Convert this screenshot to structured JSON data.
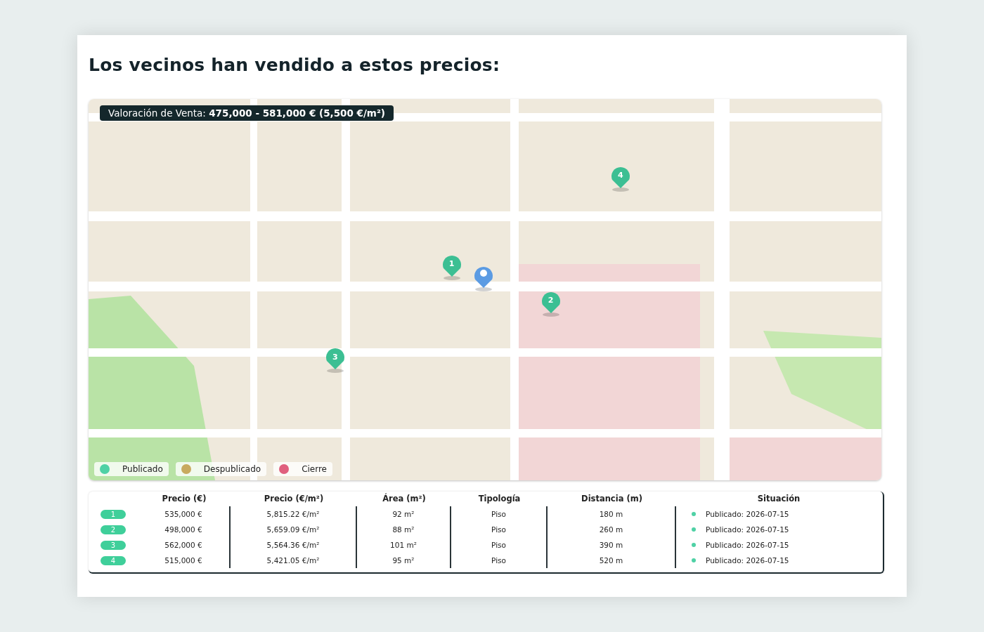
{
  "title": "Los vecinos han vendido a estos precios:",
  "map": {
    "valuation": "Valoración de Venta: **475,000 - 581,000 € (5,500 €/m²)**",
    "markers": [
      {
        "kind": "listing",
        "label": "1"
      },
      {
        "kind": "subject"
      },
      {
        "kind": "listing",
        "label": "2"
      },
      {
        "kind": "listing",
        "label": "3"
      },
      {
        "kind": "listing",
        "label": "4"
      }
    ],
    "legend": [
      {
        "label": "Publicado",
        "color": "#4fd1a5"
      },
      {
        "label": "Despublicado",
        "color": "#c8aa5e"
      },
      {
        "label": "Cierre",
        "color": "#e0607e"
      }
    ]
  },
  "table": {
    "columns": [
      "Precio (€)",
      "Precio (€/m²)",
      "Área (m²)",
      "Tipología",
      "Distancia (m)",
      "Situación"
    ],
    "rows": [
      {
        "index": "1",
        "cells": [
          "535,000 €",
          "5,815.22 €/m²",
          "92 m²",
          "Piso",
          "180 m"
        ],
        "status": "Publicado: 2026-07-15",
        "color": "#4fd1a5"
      },
      {
        "index": "2",
        "cells": [
          "498,000 €",
          "5,659.09 €/m²",
          "88 m²",
          "Piso",
          "260 m"
        ],
        "status": "Publicado: 2026-07-15",
        "color": "#4fd1a5"
      },
      {
        "index": "3",
        "cells": [
          "562,000 €",
          "5,564.36 €/m²",
          "101 m²",
          "Piso",
          "390 m"
        ],
        "status": "Publicado: 2026-07-15",
        "color": "#4fd1a5"
      },
      {
        "index": "4",
        "cells": [
          "515,000 €",
          "5,421.05 €/m²",
          "95 m²",
          "Piso",
          "520 m"
        ],
        "status": "Publicado: 2026-07-15",
        "color": "#4fd1a5"
      }
    ]
  }
}
